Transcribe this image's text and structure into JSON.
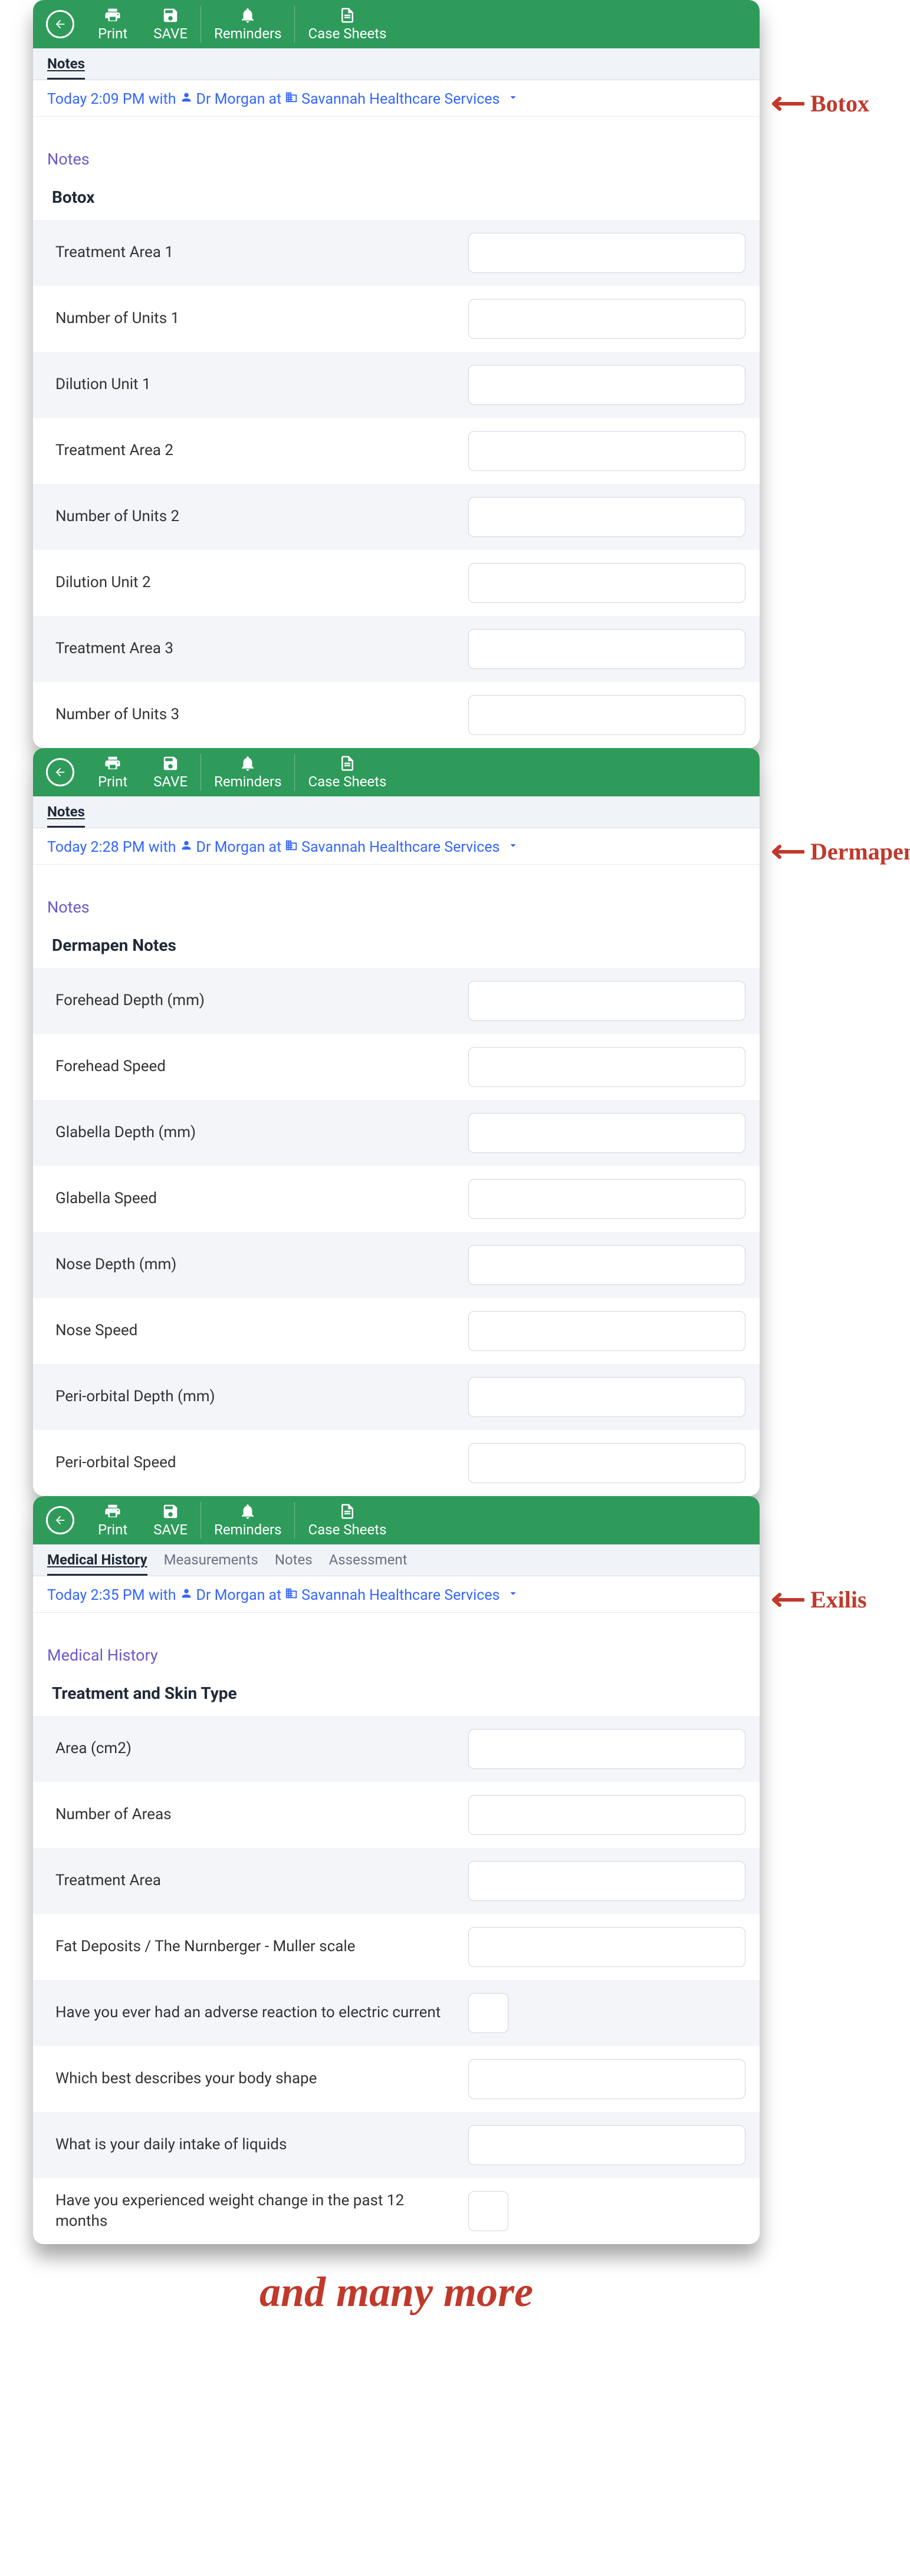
{
  "toolbar": {
    "print": "Print",
    "save": "SAVE",
    "reminders": "Reminders",
    "case_sheets": "Case Sheets"
  },
  "panels": [
    {
      "tabs": [
        "Notes"
      ],
      "active_tab": 0,
      "appt": {
        "time_prefix": "Today 2:09 PM with",
        "doctor": "Dr Morgan",
        "at": "at",
        "location": "Savannah Healthcare Services"
      },
      "section": "Notes",
      "group": "Botox",
      "rows": [
        {
          "label": "Treatment Area 1",
          "type": "text"
        },
        {
          "label": "Number of Units 1",
          "type": "text"
        },
        {
          "label": "Dilution Unit 1",
          "type": "text"
        },
        {
          "label": "Treatment Area 2",
          "type": "text"
        },
        {
          "label": "Number of Units 2",
          "type": "text"
        },
        {
          "label": "Dilution Unit 2",
          "type": "text"
        },
        {
          "label": "Treatment Area 3",
          "type": "text"
        },
        {
          "label": "Number of Units 3",
          "type": "text"
        }
      ],
      "anno": "Botox"
    },
    {
      "tabs": [
        "Notes"
      ],
      "active_tab": 0,
      "appt": {
        "time_prefix": "Today 2:28 PM with",
        "doctor": "Dr Morgan",
        "at": "at",
        "location": "Savannah Healthcare Services"
      },
      "section": "Notes",
      "group": "Dermapen Notes",
      "rows": [
        {
          "label": "Forehead Depth (mm)",
          "type": "text"
        },
        {
          "label": "Forehead Speed",
          "type": "text"
        },
        {
          "label": "Glabella Depth (mm)",
          "type": "text"
        },
        {
          "label": "Glabella Speed",
          "type": "text"
        },
        {
          "label": "Nose Depth (mm)",
          "type": "text"
        },
        {
          "label": "Nose Speed",
          "type": "text"
        },
        {
          "label": "Peri-orbital Depth (mm)",
          "type": "text"
        },
        {
          "label": "Peri-orbital Speed",
          "type": "text"
        }
      ],
      "anno": "Dermapen"
    },
    {
      "tabs": [
        "Medical History",
        "Measurements",
        "Notes",
        "Assessment"
      ],
      "active_tab": 0,
      "appt": {
        "time_prefix": "Today 2:35 PM with",
        "doctor": "Dr Morgan",
        "at": "at",
        "location": "Savannah Healthcare Services"
      },
      "section": "Medical History",
      "group": "Treatment and Skin Type",
      "rows": [
        {
          "label": "Area (cm2)",
          "type": "text"
        },
        {
          "label": "Number of Areas",
          "type": "text"
        },
        {
          "label": "Treatment Area",
          "type": "text"
        },
        {
          "label": "Fat Deposits / The Nurnberger - Muller scale",
          "type": "text"
        },
        {
          "label": "Have you ever had an adverse reaction to electric current",
          "type": "checkbox"
        },
        {
          "label": "Which best describes your body shape",
          "type": "text"
        },
        {
          "label": "What is your daily intake of liquids",
          "type": "text"
        },
        {
          "label": "Have you experienced weight change in the past 12 months",
          "type": "checkbox"
        }
      ],
      "anno": "Exilis"
    }
  ],
  "footer": "and many more"
}
